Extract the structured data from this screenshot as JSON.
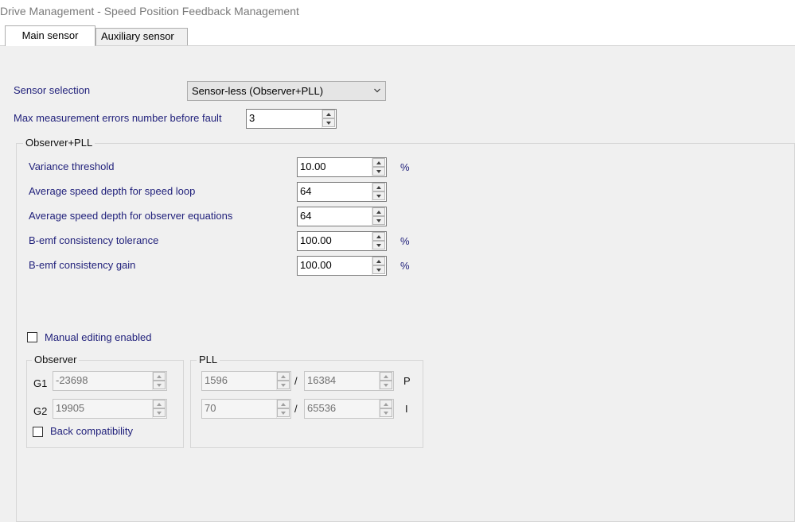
{
  "window": {
    "title": "Drive Management - Speed Position Feedback Management"
  },
  "tabs": [
    {
      "label": "Main sensor",
      "active": true
    },
    {
      "label": "Auxiliary sensor",
      "active": false
    }
  ],
  "sensor_selection": {
    "label": "Sensor selection",
    "value": "Sensor-less (Observer+PLL)"
  },
  "max_errors": {
    "label": "Max measurement errors number before fault",
    "value": "3"
  },
  "observer_pll_group": {
    "title": "Observer+PLL",
    "rows": [
      {
        "label": "Variance threshold",
        "value": "10.00",
        "unit": "%"
      },
      {
        "label": "Average speed depth for speed loop",
        "value": "64",
        "unit": ""
      },
      {
        "label": "Average speed depth for observer equations",
        "value": "64",
        "unit": ""
      },
      {
        "label": "B-emf consistency tolerance",
        "value": "100.00",
        "unit": "%"
      },
      {
        "label": "B-emf consistency gain",
        "value": "100.00",
        "unit": "%"
      }
    ]
  },
  "manual_editing": {
    "label": "Manual editing enabled",
    "checked": false
  },
  "observer": {
    "title": "Observer",
    "g1_label": "G1",
    "g1_value": "-23698",
    "g2_label": "G2",
    "g2_value": "19905",
    "back_compat": {
      "label": "Back compatibility",
      "checked": false
    }
  },
  "pll": {
    "title": "PLL",
    "p_num": "1596",
    "p_den": "16384",
    "p_label": "P",
    "i_num": "70",
    "i_den": "65536",
    "i_label": "I",
    "separator": "/"
  },
  "colors": {
    "label_blue": "#1f1f7a",
    "panel_bg": "#f0f0f0"
  },
  "icons": [
    "chevron-down-icon",
    "spin-up-icon",
    "spin-down-icon",
    "checkbox-icon"
  ]
}
